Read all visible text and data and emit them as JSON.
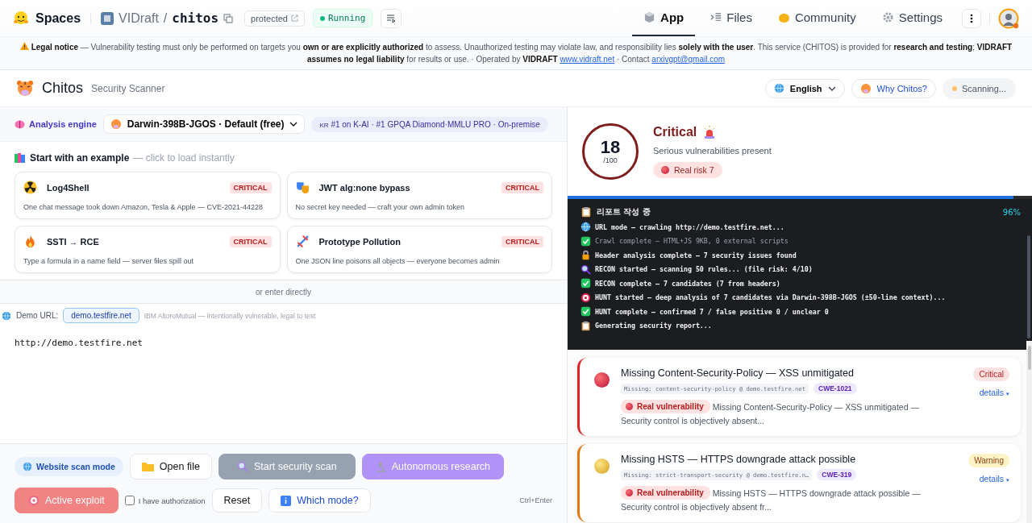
{
  "topbar": {
    "brand": "Spaces",
    "owner": "VIDraft",
    "separator": "/",
    "repo": "chitos",
    "visibility": "protected",
    "status": "Running",
    "tabs": [
      {
        "label": "App",
        "selected": true
      },
      {
        "label": "Files",
        "selected": false
      },
      {
        "label": "Community",
        "selected": false
      },
      {
        "label": "Settings",
        "selected": false
      }
    ]
  },
  "legal_notice": {
    "text": "**Legal notice** — Vulnerability testing must only be performed on targets you **own or are explicitly authorized** to assess. Unauthorized testing may violate law, and responsibility lies **solely with the user**. This service (CHITOS) is provided for **research and testing**; **VIDRAFT assumes no legal liability** for results or use. · Operated by **VIDRAFT**",
    "site_link": "www.vidraft.net",
    "contact_label": "· Contact",
    "contact_link": "arxivgpt@gmail.com"
  },
  "app_header": {
    "title": "Chitos",
    "subtitle": "Security Scanner",
    "language": "English",
    "why_button": "Why Chitos?",
    "scan_status": "Scanning..."
  },
  "engine": {
    "label": "Analysis engine",
    "model": "Darwin-398B-JGOS · Default (free)",
    "badge_flag": "KR",
    "badge": "#1 on K-AI · #1 GPQA Diamond·MMLU PRO · On-premise"
  },
  "examples": {
    "title": "Start with an example",
    "hint": "— click to load instantly",
    "items": [
      {
        "title": "Log4Shell",
        "severity": "CRITICAL",
        "description": "One chat message took down Amazon, Tesla & Apple — CVE-2021-44228"
      },
      {
        "title": "JWT alg:none bypass",
        "severity": "CRITICAL",
        "description": "No secret key needed — craft your own admin token"
      },
      {
        "title": "SSTI → RCE",
        "severity": "CRITICAL",
        "description": "Type a formula in a name field — server files spill out"
      },
      {
        "title": "Prototype Pollution",
        "severity": "CRITICAL",
        "description": "One JSON line poisons all objects — everyone becomes admin"
      }
    ]
  },
  "divider_label": "or enter directly",
  "demo": {
    "label": "Demo URL:",
    "url": "demo.testfire.net",
    "note": "IBM AltoroMutual — intentionally vulnerable, legal to test"
  },
  "input": {
    "value": "http://demo.testfire.net"
  },
  "actions": {
    "mode": "Website scan mode",
    "open_file": {
      "label": "Open file",
      "disabled": false
    },
    "scan": {
      "label": "Start security scan",
      "disabled": true
    },
    "research": {
      "label": "Autonomous research",
      "disabled": true
    },
    "exploit": {
      "label": "Active exploit",
      "disabled": true
    },
    "authorization": {
      "label": "I have authorization",
      "checked": false
    },
    "reset": "Reset",
    "which_mode": "Which mode?",
    "shortcut": "Ctrl+Enter"
  },
  "score": {
    "value": "18",
    "max": "/100",
    "level_label": "Critical",
    "summary": "Serious vulnerabilities present",
    "risk": "Real risk 7"
  },
  "progress": {
    "level": 0.96,
    "title": "리포트 작성 중",
    "percent": "96%"
  },
  "log": [
    {
      "kind": "globe",
      "text": "URL mode — crawling http://demo.testfire.net...",
      "dimmed": false
    },
    {
      "kind": "check",
      "text": "Crawl complete — HTML+JS 9KB, 0 external scripts",
      "dimmed": true
    },
    {
      "kind": "lock",
      "text": "Header analysis complete — 7 security issues found",
      "dimmed": false
    },
    {
      "kind": "search",
      "text": "RECON started — scanning 50 rules... (file risk: 4/10)",
      "dimmed": false
    },
    {
      "kind": "check",
      "text": "RECON complete — 7 candidates (7 from headers)",
      "dimmed": false
    },
    {
      "kind": "target",
      "text": "HUNT started — deep analysis of 7 candidates via Darwin-398B-JGOS (±50-line context)...",
      "dimmed": false
    },
    {
      "kind": "check",
      "text": "HUNT complete — confirmed 7 / false positive 0 / unclear 0",
      "dimmed": false
    },
    {
      "kind": "clipboard",
      "text": "Generating security report...",
      "dimmed": false
    }
  ],
  "findings": [
    {
      "kind": "critical",
      "title": "Missing Content-Security-Policy — XSS unmitigated",
      "badge": "Critical",
      "evidence": "Missing: content-security-policy @ demo.testfire.net",
      "cwe": "CWE-1021",
      "verdict": "Real vulnerability",
      "description": "Missing Content-Security-Policy — XSS unmitigated — Security control is objectively absent...",
      "details": "details",
      "caret": "▾"
    },
    {
      "kind": "warning",
      "title": "Missing HSTS — HTTPS downgrade attack possible",
      "badge": "Warning",
      "evidence": "Missing: strict-transport-security @ demo.testfire.n…",
      "cwe": "CWE-319",
      "verdict": "Real vulnerability",
      "description": "Missing HSTS — HTTPS downgrade attack possible — Security control is objectively absent fr...",
      "details": "details",
      "caret": "▾"
    }
  ]
}
